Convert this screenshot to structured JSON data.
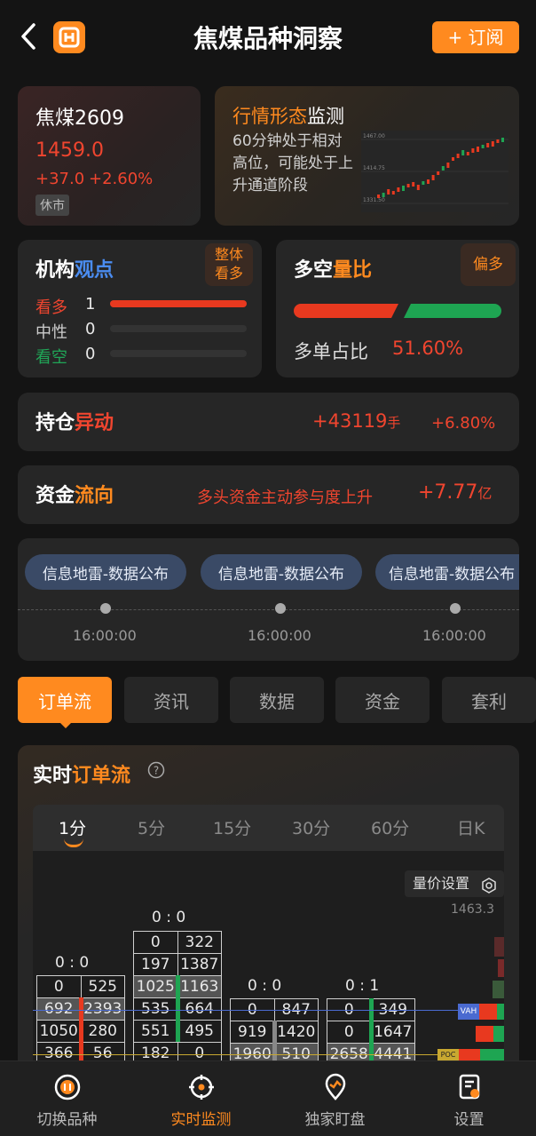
{
  "header": {
    "title": "焦煤品种洞察",
    "subscribe_label": "+ 订阅"
  },
  "quote": {
    "name": "焦煤2609",
    "price": "1459.0",
    "change": "+37.0",
    "change_pct": "+2.60%",
    "status": "休市"
  },
  "pattern": {
    "title_a": "行情形态",
    "title_b": "监测",
    "desc": "60分钟处于相对高位，可能处于上升通道阶段",
    "mini_labels": [
      "1467.00",
      "1414.75",
      "1331.50"
    ]
  },
  "views": {
    "title_a": "机构",
    "title_b": "观点",
    "badge": "整体看多",
    "rows": [
      {
        "label": "看多",
        "count": "1",
        "fraction": 1.0
      },
      {
        "label": "中性",
        "count": "0",
        "fraction": 0
      },
      {
        "label": "看空",
        "count": "0",
        "fraction": 0
      }
    ]
  },
  "longshort": {
    "title_a": "多空",
    "title_b": "量比",
    "badge": "偏多",
    "ratio_label": "多单占比",
    "ratio_value": "51.60%",
    "long_fraction": 0.516
  },
  "position": {
    "title_a": "持仓",
    "title_b": "异动",
    "value": "+43119",
    "unit": "手",
    "pct": "+6.80%"
  },
  "funds": {
    "title_a": "资金",
    "title_b": "流向",
    "desc": "多头资金主动参与度上升",
    "value": "+7.77",
    "unit": "亿"
  },
  "events": [
    {
      "label": "信息地雷-数据公布",
      "time": "16:00:00"
    },
    {
      "label": "信息地雷-数据公布",
      "time": "16:00:00"
    },
    {
      "label": "信息地雷-数据公布",
      "time": "16:00:00"
    }
  ],
  "tabs": [
    "订单流",
    "资讯",
    "数据",
    "资金",
    "套利"
  ],
  "orderflow": {
    "title_a": "实时",
    "title_b": "订单流",
    "timeframes": [
      "1分",
      "5分",
      "15分",
      "30分",
      "60分",
      "日K"
    ],
    "settings_label": "量价设置",
    "top_price": "1463.3",
    "vah_label": "VAH",
    "poc_label": "POC",
    "columns": [
      {
        "ratio": "0 : 0",
        "rows": [
          [
            "0",
            "525"
          ],
          [
            "692",
            "2393"
          ],
          [
            "1050",
            "280"
          ],
          [
            "366",
            "56"
          ]
        ]
      },
      {
        "ratio": "0 : 0",
        "rows": [
          [
            "0",
            "322"
          ],
          [
            "197",
            "1387"
          ],
          [
            "1025",
            "1163"
          ],
          [
            "535",
            "664"
          ],
          [
            "551",
            "495"
          ],
          [
            "182",
            "0"
          ]
        ]
      },
      {
        "ratio": "0 : 0",
        "rows": [
          [
            "0",
            "847"
          ],
          [
            "919",
            "1420"
          ],
          [
            "1960",
            "510"
          ]
        ]
      },
      {
        "ratio": "0 : 1",
        "rows": [
          [
            "0",
            "349"
          ],
          [
            "0",
            "1647"
          ],
          [
            "2658",
            "4441"
          ]
        ]
      }
    ]
  },
  "nav": [
    {
      "label": "切换品种"
    },
    {
      "label": "实时监测"
    },
    {
      "label": "独家盯盘"
    },
    {
      "label": "设置"
    }
  ],
  "colors": {
    "accent": "#ff8a1f",
    "up": "#f0452f",
    "down": "#20a557"
  }
}
